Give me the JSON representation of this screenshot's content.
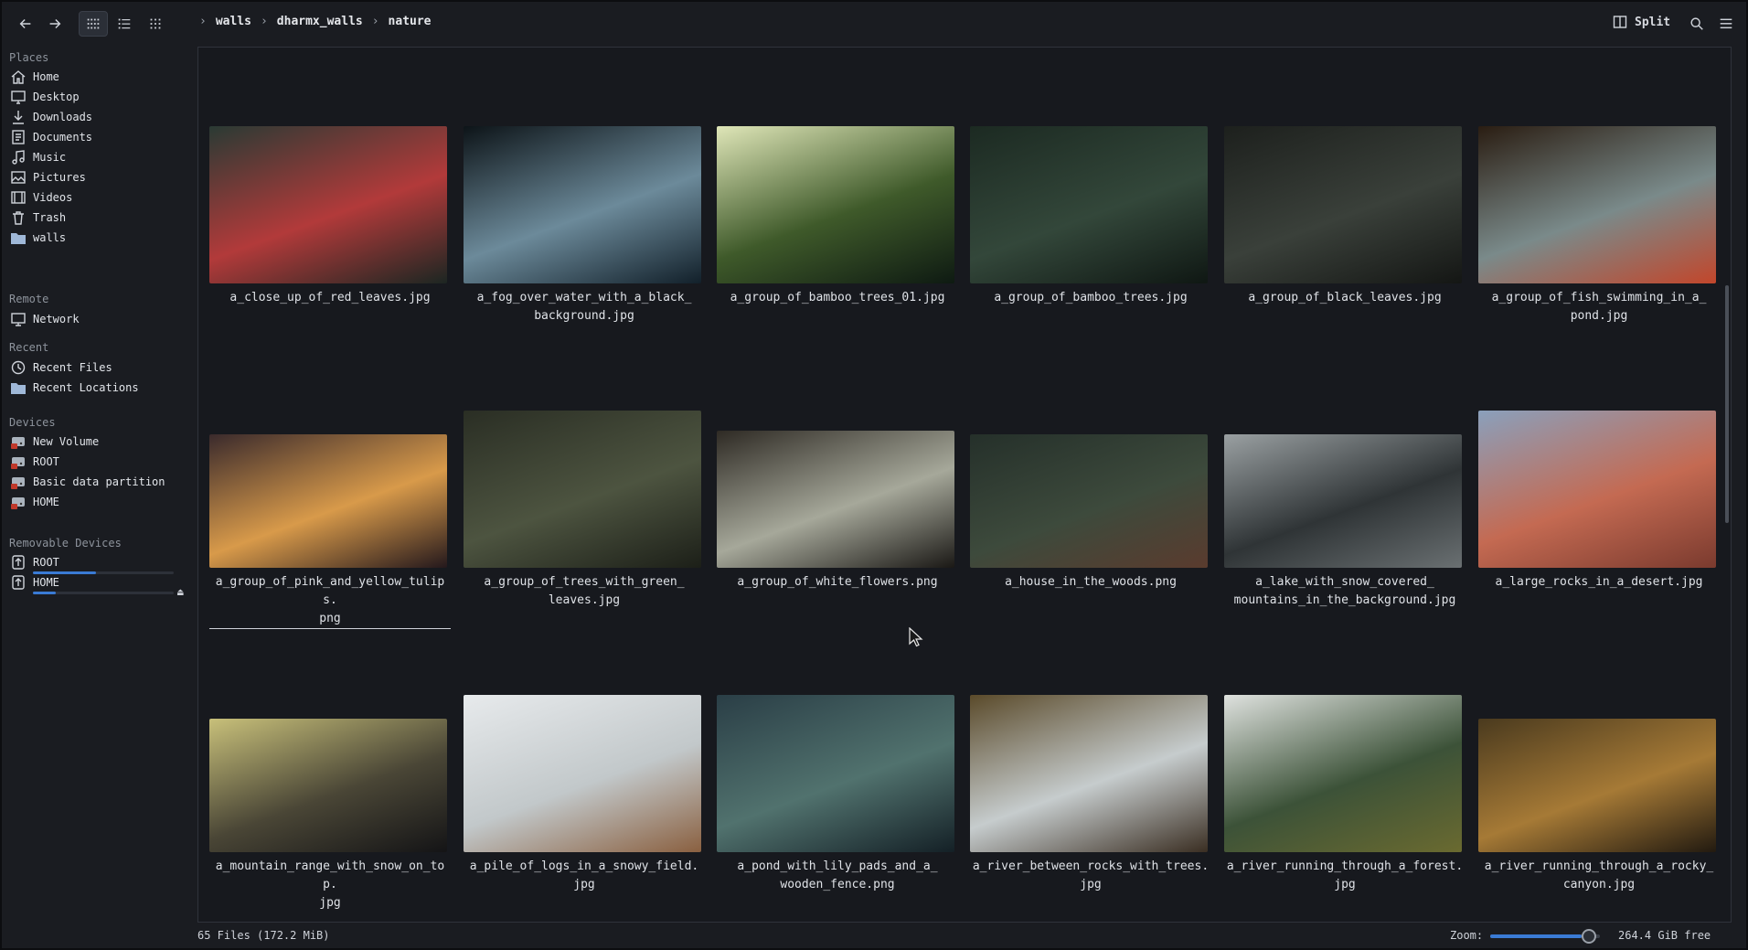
{
  "toolbar": {
    "breadcrumb": [
      "walls",
      "dharmx_walls",
      "nature"
    ],
    "split_label": "Split"
  },
  "sidebar": {
    "places_title": "Places",
    "places": [
      {
        "label": "Home",
        "icon": "home-icon"
      },
      {
        "label": "Desktop",
        "icon": "desktop-icon"
      },
      {
        "label": "Downloads",
        "icon": "download-icon"
      },
      {
        "label": "Documents",
        "icon": "document-icon"
      },
      {
        "label": "Music",
        "icon": "music-icon"
      },
      {
        "label": "Pictures",
        "icon": "picture-icon"
      },
      {
        "label": "Videos",
        "icon": "video-icon"
      },
      {
        "label": "Trash",
        "icon": "trash-icon"
      },
      {
        "label": "walls",
        "icon": "folder-icon"
      }
    ],
    "remote_title": "Remote",
    "remote": [
      {
        "label": "Network",
        "icon": "network-icon"
      }
    ],
    "recent_title": "Recent",
    "recent": [
      {
        "label": "Recent Files",
        "icon": "clock-icon"
      },
      {
        "label": "Recent Locations",
        "icon": "folder-icon"
      }
    ],
    "devices_title": "Devices",
    "devices": [
      {
        "label": "New Volume",
        "icon": "drive-icon"
      },
      {
        "label": "ROOT",
        "icon": "drive-icon"
      },
      {
        "label": "Basic data partition",
        "icon": "drive-icon"
      },
      {
        "label": "HOME",
        "icon": "drive-icon"
      }
    ],
    "removable_title": "Removable Devices",
    "removable": [
      {
        "label": "ROOT",
        "icon": "usb-drive-icon",
        "usage": 0.45
      },
      {
        "label": "HOME",
        "icon": "usb-drive-icon",
        "usage": 0.16
      }
    ]
  },
  "files": [
    {
      "name": "a_close_up_of_red_leaves.jpg",
      "colors": [
        "#2a3a34",
        "#b23a3a",
        "#1c2622"
      ]
    },
    {
      "name": "a_fog_over_water_with_a_black_\nbackground.jpg",
      "colors": [
        "#0d1418",
        "#6c8a9a",
        "#12202a"
      ]
    },
    {
      "name": "a_group_of_bamboo_trees_01.jpg",
      "colors": [
        "#dfe6b8",
        "#3f5a2a",
        "#0e1a12"
      ]
    },
    {
      "name": "a_group_of_bamboo_trees.jpg",
      "colors": [
        "#1c2a22",
        "#33473a",
        "#0f1713"
      ]
    },
    {
      "name": "a_group_of_black_leaves.jpg",
      "colors": [
        "#1d201d",
        "#3a403a",
        "#141614"
      ]
    },
    {
      "name": "a_group_of_fish_swimming_in_a_\npond.jpg",
      "colors": [
        "#2a1d12",
        "#7a8a8a",
        "#c2462b"
      ]
    },
    {
      "name": "a_group_of_pink_and_yellow_tulips.\npng",
      "colors": [
        "#3a2a2c",
        "#d89a4a",
        "#24181c"
      ]
    },
    {
      "name": "a_group_of_trees_with_green_\nleaves.jpg",
      "colors": [
        "#2a2e24",
        "#4d5440",
        "#1c1f18"
      ]
    },
    {
      "name": "a_group_of_white_flowers.png",
      "colors": [
        "#2e2a24",
        "#a6a89a",
        "#1a1815"
      ]
    },
    {
      "name": "a_house_in_the_woods.png",
      "colors": [
        "#25302a",
        "#3d4a3c",
        "#5a3b2e"
      ]
    },
    {
      "name": "a_lake_with_snow_covered_\nmountains_in_the_background.jpg",
      "colors": [
        "#9aa0a2",
        "#2f3436",
        "#6a7072"
      ]
    },
    {
      "name": "a_large_rocks_in_a_desert.jpg",
      "colors": [
        "#8aa0bc",
        "#c46a52",
        "#7a3a2e"
      ]
    },
    {
      "name": "a_mountain_range_with_snow_on_top.\njpg",
      "colors": [
        "#c8c07a",
        "#4a4636",
        "#141416"
      ]
    },
    {
      "name": "a_pile_of_logs_in_a_snowy_field.\njpg",
      "colors": [
        "#e7eaec",
        "#c2c8ca",
        "#8a6040"
      ]
    },
    {
      "name": "a_pond_with_lily_pads_and_a_\nwooden_fence.png",
      "colors": [
        "#2a3e46",
        "#51726e",
        "#142026"
      ]
    },
    {
      "name": "a_river_between_rocks_with_trees.\njpg",
      "colors": [
        "#5a4a2a",
        "#c6cccd",
        "#3a2e22"
      ]
    },
    {
      "name": "a_river_running_through_a_forest.\njpg",
      "colors": [
        "#dfe2df",
        "#3c5238",
        "#6a6a30"
      ]
    },
    {
      "name": "a_river_running_through_a_rocky_\ncanyon.jpg",
      "colors": [
        "#4a3a1e",
        "#a67a36",
        "#221a10"
      ]
    }
  ],
  "status": {
    "count": "65 Files (172.2 MiB)",
    "zoom_label": "Zoom:",
    "free": "264.4 GiB free",
    "zoom_level": 0.9
  }
}
